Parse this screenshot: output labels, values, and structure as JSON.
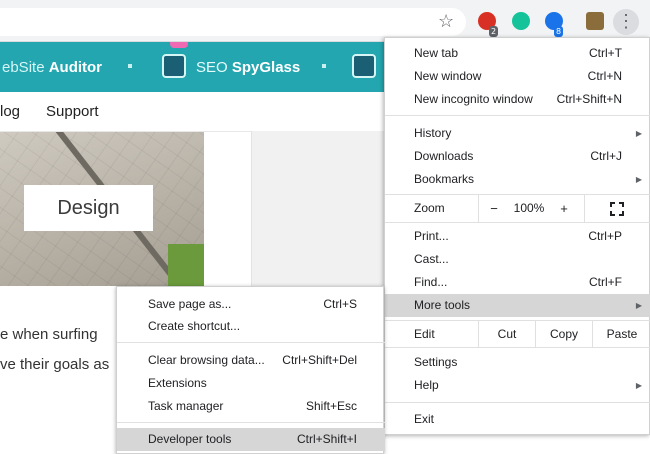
{
  "toolbar": {
    "extensions": [
      {
        "icon": "extension-red-icon",
        "color": "#d93025",
        "badge": "2"
      },
      {
        "icon": "grammarly-icon",
        "color": "#15c39a",
        "badge": ""
      },
      {
        "icon": "extension-blue-icon",
        "color": "#1a73e8",
        "badge": "8"
      },
      {
        "icon": "extension-profile-icon",
        "color": "#8a6d3b",
        "badge": ""
      }
    ]
  },
  "site": {
    "brand_site_prefix": "ebSite ",
    "brand_site_bold": "Auditor",
    "brand_seo_prefix": "SEO ",
    "brand_seo_bold": "SpyGlass",
    "nav_blog": "log",
    "nav_support": "Support",
    "design_label": "Design",
    "body_line_1": "e when surfing",
    "body_line_2": "ve their goals as",
    "header_color": "#23a6b0"
  },
  "menu": {
    "new_tab": {
      "label": "New tab",
      "shortcut": "Ctrl+T"
    },
    "new_window": {
      "label": "New window",
      "shortcut": "Ctrl+N"
    },
    "new_incognito": {
      "label": "New incognito window",
      "shortcut": "Ctrl+Shift+N"
    },
    "history": {
      "label": "History"
    },
    "downloads": {
      "label": "Downloads",
      "shortcut": "Ctrl+J"
    },
    "bookmarks": {
      "label": "Bookmarks"
    },
    "zoom": {
      "label": "Zoom",
      "minus": "−",
      "value": "100%",
      "plus": "+"
    },
    "print": {
      "label": "Print...",
      "shortcut": "Ctrl+P"
    },
    "cast": {
      "label": "Cast..."
    },
    "find": {
      "label": "Find...",
      "shortcut": "Ctrl+F"
    },
    "more_tools": {
      "label": "More tools"
    },
    "edit": {
      "label": "Edit",
      "cut": "Cut",
      "copy": "Copy",
      "paste": "Paste"
    },
    "settings": {
      "label": "Settings"
    },
    "help": {
      "label": "Help"
    },
    "exit": {
      "label": "Exit"
    }
  },
  "submenu": {
    "save_page": {
      "label": "Save page as...",
      "shortcut": "Ctrl+S"
    },
    "create_shortcut": {
      "label": "Create shortcut..."
    },
    "clear_data": {
      "label": "Clear browsing data...",
      "shortcut": "Ctrl+Shift+Del"
    },
    "extensions": {
      "label": "Extensions"
    },
    "task_manager": {
      "label": "Task manager",
      "shortcut": "Shift+Esc"
    },
    "developer_tools": {
      "label": "Developer tools",
      "shortcut": "Ctrl+Shift+I"
    }
  },
  "highlight_color": "#d6d6d6"
}
